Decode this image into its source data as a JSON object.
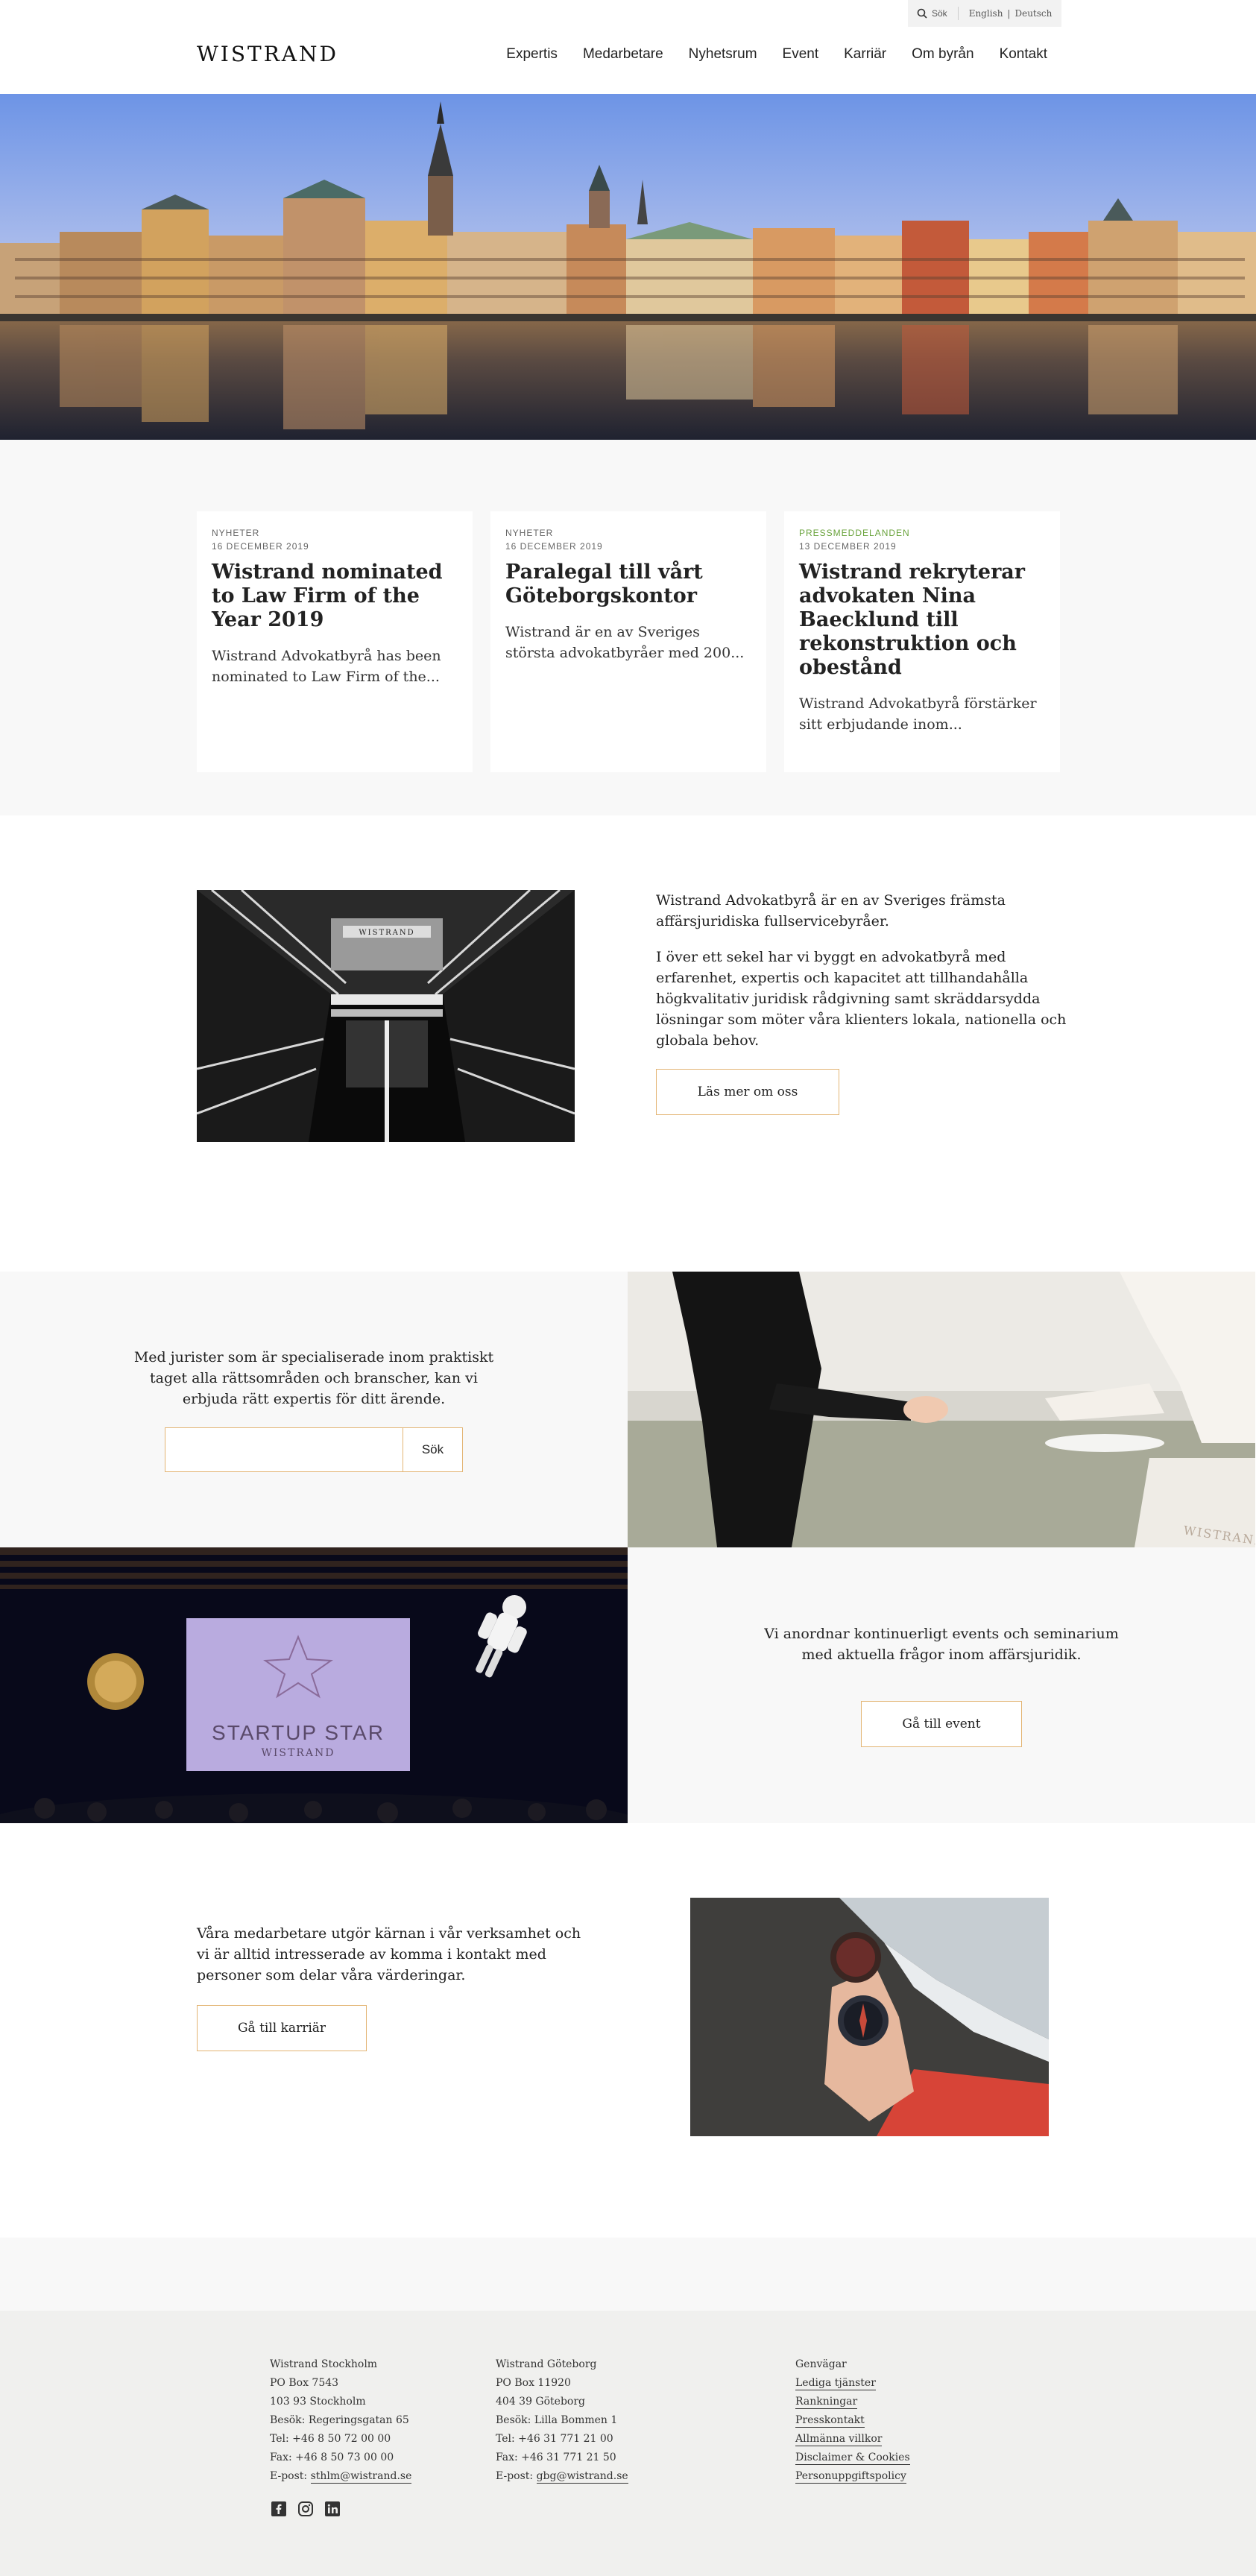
{
  "header": {
    "logo": "WISTRAND",
    "search_label": "Sök",
    "lang_english": "English",
    "lang_sep": "|",
    "lang_deutsch": "Deutsch",
    "nav": [
      "Expertis",
      "Medarbetare",
      "Nyhetsrum",
      "Event",
      "Karriär",
      "Om byrån",
      "Kontakt"
    ]
  },
  "news": [
    {
      "category": "NYHETER",
      "date": "16 DECEMBER 2019",
      "title": "Wistrand nominated to Law Firm of the Year 2019",
      "excerpt": "Wistrand Advokatbyrå has been nominated to Law Firm of the..."
    },
    {
      "category": "NYHETER",
      "date": "16 DECEMBER 2019",
      "title": "Paralegal till vårt Göteborgskontor",
      "excerpt": "Wistrand är en av Sveriges största advokatbyråer med 200..."
    },
    {
      "category": "PRESSMEDDELANDEN",
      "date": "13 DECEMBER 2019",
      "title": "Wistrand rekryterar advokaten Nina Baecklund till rekonstruktion och obestånd",
      "excerpt": "Wistrand Advokatbyrå förstärker sitt erbjudande inom..."
    }
  ],
  "about": {
    "p1": "Wistrand Advokatbyrå är en av Sveriges främsta affärsjuridiska fullservicebyråer.",
    "p2": "I över ett sekel har vi byggt en advokatbyrå med erfarenhet, expertis och kapacitet att tillhandahålla högkvalitativ juridisk rådgivning samt skräddarsydda lösningar som möter våra klienters lokala, nationella och globala behov.",
    "button": "Läs mer om oss"
  },
  "expertise": {
    "text": "Med jurister som är specialiserade inom praktiskt taget alla rättsområden och branscher, kan vi erbjuda rätt expertis för ditt ärende.",
    "search_button": "Sök",
    "search_value": ""
  },
  "images": {
    "atrium_sign": "WISTRAND",
    "bag_brand": "WISTRAND",
    "screen_title": "STARTUP STAR",
    "screen_sub": "WISTRAND"
  },
  "events": {
    "text": "Vi anordnar kontinuerligt events och seminarium med aktuella frågor inom affärsjuridik.",
    "button": "Gå till event"
  },
  "careers": {
    "text": "Våra medarbetare utgör kärnan i vår verksamhet och vi är alltid intresserade av komma i kontakt med personer som delar våra värderingar.",
    "button": "Gå till karriär"
  },
  "footer": {
    "stockholm": {
      "name": "Wistrand Stockholm",
      "box": "PO Box 7543",
      "city": "103 93 Stockholm",
      "visit": "Besök: Regeringsgatan 65",
      "tel": "Tel: +46 8 50 72 00 00",
      "fax": "Fax: +46 8 50 73 00 00",
      "email_label": "E-post: ",
      "email": "sthlm@wistrand.se"
    },
    "goteborg": {
      "name": "Wistrand Göteborg",
      "box": "PO Box 11920",
      "city": "404 39 Göteborg",
      "visit": "Besök: Lilla Bommen 1",
      "tel": "Tel: +46 31 771 21 00",
      "fax": "Fax: +46 31 771 21 50",
      "email_label": "E-post: ",
      "email": "gbg@wistrand.se"
    },
    "shortcuts": {
      "title": "Genvägar",
      "links": [
        "Lediga tjänster",
        "Rankningar",
        "Presskontakt",
        "Allmänna villkor",
        "Disclaimer & Cookies",
        "Personuppgiftspolicy"
      ]
    },
    "social": [
      "facebook-icon",
      "instagram-icon",
      "linkedin-icon"
    ]
  }
}
